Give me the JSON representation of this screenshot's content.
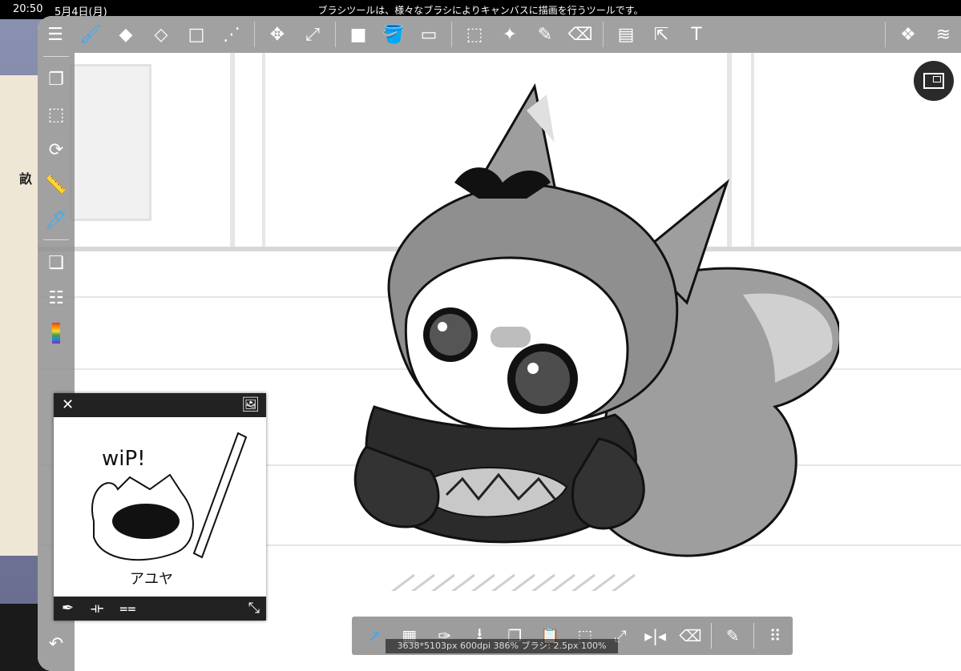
{
  "status_bar": {
    "time": "20:50",
    "date": "5月4日(月)",
    "tool_hint": "ブラシツールは、様々なブラシによりキャンバスに描画を行うツールです。"
  },
  "background_app": {
    "kanji": "畝"
  },
  "colors": {
    "accent": "#3fa9f5",
    "toolbar": "#8c8c8c",
    "panel_dark": "#222222"
  },
  "top_toolbar": {
    "groups": [
      [
        {
          "icon": "menu-icon",
          "glyph": "☰",
          "active": false
        },
        {
          "icon": "brush-icon",
          "glyph": "🖌",
          "active": true
        },
        {
          "icon": "eraser-icon",
          "glyph": "◆",
          "active": false
        },
        {
          "icon": "blur-eraser-icon",
          "glyph": "◇",
          "active": false
        },
        {
          "icon": "rectangle-icon",
          "glyph": "□",
          "active": false
        },
        {
          "icon": "dot-line-icon",
          "glyph": "⋰",
          "active": false
        }
      ],
      [
        {
          "icon": "move-icon",
          "glyph": "✥",
          "active": false
        },
        {
          "icon": "transform-icon",
          "glyph": "⤢",
          "active": false
        }
      ],
      [
        {
          "icon": "fill-color-icon",
          "glyph": "■",
          "active": false
        },
        {
          "icon": "bucket-icon",
          "glyph": "🪣",
          "active": false
        },
        {
          "icon": "gradient-icon",
          "glyph": "▭",
          "active": false
        }
      ],
      [
        {
          "icon": "select-icon",
          "glyph": "⬚",
          "active": false
        },
        {
          "icon": "magic-wand-icon",
          "glyph": "✦",
          "active": false
        },
        {
          "icon": "select-pen-icon",
          "glyph": "✎",
          "active": false
        },
        {
          "icon": "select-eraser-icon",
          "glyph": "⌫",
          "active": false
        }
      ],
      [
        {
          "icon": "frame-icon",
          "glyph": "▤",
          "active": false
        },
        {
          "icon": "operate-icon",
          "glyph": "⇱",
          "active": false
        },
        {
          "icon": "text-icon",
          "glyph": "T",
          "active": false
        }
      ]
    ],
    "right": [
      {
        "icon": "materials-icon",
        "glyph": "❖"
      },
      {
        "icon": "layers-icon",
        "glyph": "≋"
      }
    ]
  },
  "left_toolbar": [
    {
      "icon": "pages-icon",
      "glyph": "❐",
      "active": false
    },
    {
      "icon": "selection-icon",
      "glyph": "⬚",
      "active": false
    },
    {
      "icon": "rotate-icon",
      "glyph": "⟳",
      "active": false
    },
    {
      "icon": "ruler-icon",
      "glyph": "📏",
      "active": false
    },
    {
      "icon": "brush-color-icon",
      "glyph": "🖊",
      "active": true
    },
    {
      "sep": true
    },
    {
      "icon": "layer-copy-icon",
      "glyph": "❏",
      "active": false
    },
    {
      "icon": "list-icon",
      "glyph": "☷",
      "active": false
    },
    {
      "icon": "color-palette-icon",
      "glyph": "rainbow",
      "active": false
    }
  ],
  "left_bottom": {
    "icon": "undo-icon",
    "glyph": "↶"
  },
  "preview_panel": {
    "close_glyph": "✕",
    "image_glyph": "🖼",
    "sketch_title": "wiP!",
    "sketch_signature": "アユヤ",
    "footer": [
      {
        "icon": "eyedropper-icon",
        "glyph": "✒"
      },
      {
        "icon": "flip-horizontal-icon",
        "glyph": "⟛"
      },
      {
        "icon": "flip-vertical-icon",
        "glyph": "⩵"
      }
    ],
    "expand_glyph": "⤡"
  },
  "bottom_bar": [
    {
      "icon": "brush-size-icon",
      "glyph": "↗",
      "active": true
    },
    {
      "icon": "transparent-swatch-icon",
      "glyph": "▦",
      "active": false
    },
    {
      "icon": "dropper-icon",
      "glyph": "✑",
      "active": false
    },
    {
      "icon": "download-icon",
      "glyph": "⭳",
      "active": false
    },
    {
      "icon": "copy-icon",
      "glyph": "❐",
      "active": false
    },
    {
      "icon": "paste-icon",
      "glyph": "📋",
      "active": false
    },
    {
      "icon": "select-all-icon",
      "glyph": "⬚",
      "active": false
    },
    {
      "icon": "transform-sel-icon",
      "glyph": "⤢",
      "active": false
    },
    {
      "icon": "mirror-icon",
      "glyph": "▸|◂",
      "active": false
    },
    {
      "icon": "clear-icon",
      "glyph": "⌫",
      "active": false
    },
    {
      "sep": true
    },
    {
      "icon": "edit-icon",
      "glyph": "✎",
      "active": false
    },
    {
      "sep": true
    },
    {
      "icon": "grip-icon",
      "glyph": "⠿",
      "active": false
    }
  ],
  "canvas_info": "3638*5103px 600dpi 386% ブラシ: 2.5px 100%"
}
